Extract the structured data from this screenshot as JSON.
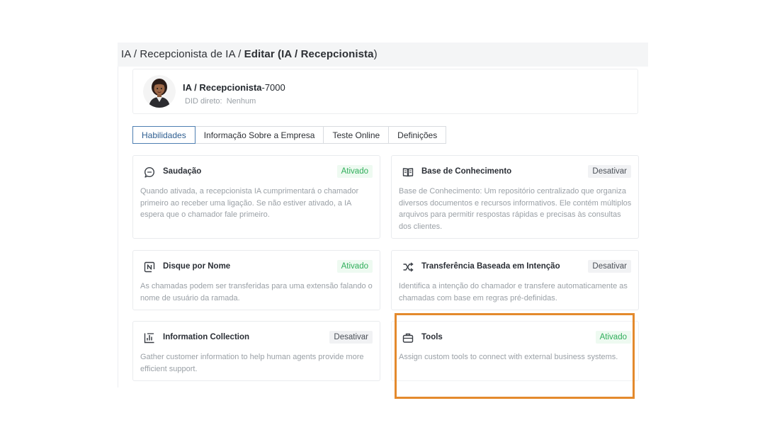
{
  "breadcrumb": {
    "part1": "IA",
    "sep1": " / ",
    "part2": "Recepcionista de IA",
    "sep2": " / ",
    "current_prefix": "Editar (",
    "current_name": "IA / Recepcionista",
    "current_suffix": ")"
  },
  "agent": {
    "name_bold": "IA / Recepcionista",
    "name_suffix": "-7000",
    "did_label": "DID direto:",
    "did_value": "Nenhum"
  },
  "tabs": [
    {
      "label": "Habilidades",
      "active": true
    },
    {
      "label": "Informação Sobre a Empresa",
      "active": false
    },
    {
      "label": "Teste Online",
      "active": false
    },
    {
      "label": "Definições",
      "active": false
    }
  ],
  "skills": [
    {
      "title": "Saudação",
      "status": "Ativado",
      "icon": "chat-bubble-icon",
      "description": "Quando ativada, a recepcionista IA cumprimentará o chamador primeiro ao receber uma ligação. Se não estiver ativado, a IA espera que o chamador fale primeiro."
    },
    {
      "title": "Base de Conhecimento",
      "status": "Desativar",
      "icon": "book-icon",
      "description": "Base de Conhecimento: Um repositório centralizado que organiza diversos documentos e recursos informativos. Ele contém múltiplos arquivos para permitir respostas rápidas e precisas às consultas dos clientes."
    },
    {
      "title": "Disque por Nome",
      "status": "Ativado",
      "icon": "name-dial-icon",
      "description": "As chamadas podem ser transferidas para uma extensão falando o nome de usuário da ramada."
    },
    {
      "title": "Transferência Baseada em Intenção",
      "status": "Desativar",
      "icon": "shuffle-icon",
      "description": "Identifica a intenção do chamador e transfere automaticamente as chamadas com base em regras pré-definidas."
    },
    {
      "title": "Information Collection",
      "status": "Desativar",
      "icon": "chart-collection-icon",
      "description": "Gather customer information to help human agents provide more efficient support."
    },
    {
      "title": "Tools",
      "status": "Ativado",
      "icon": "toolbox-icon",
      "description": "Assign custom tools to connect with external business systems."
    }
  ],
  "colors": {
    "accent": "#4e7fb2",
    "enabled_text": "#2fae5a",
    "enabled_bg": "#eefaf1",
    "highlight": "#e48a2d"
  }
}
